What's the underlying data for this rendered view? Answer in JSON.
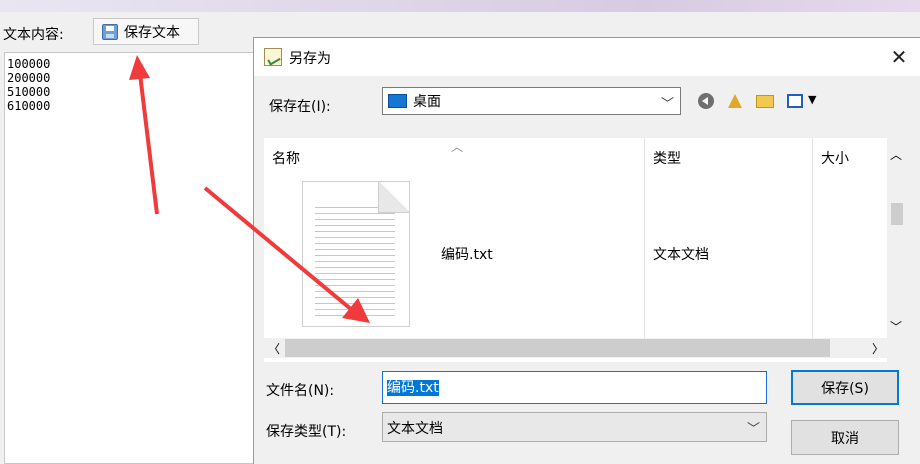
{
  "app": {
    "content_label": "文本内容:",
    "save_text_button": "保存文本",
    "text_lines": [
      "100000",
      "200000",
      "510000",
      "610000"
    ]
  },
  "dialog": {
    "title": "另存为",
    "save_in_label": "保存在(I):",
    "location": "桌面",
    "columns": {
      "name": "名称",
      "type": "类型",
      "size": "大小"
    },
    "files": [
      {
        "name": "编码.txt",
        "type": "文本文档"
      }
    ],
    "filename_label": "文件名(N):",
    "filename_value": "编码.txt",
    "filetype_label": "保存类型(T):",
    "filetype_value": "文本文档",
    "save_button": "保存(S)",
    "cancel_button": "取消"
  },
  "colors": {
    "annotation_arrow": "#ef3b3b",
    "selection": "#0078d7"
  }
}
